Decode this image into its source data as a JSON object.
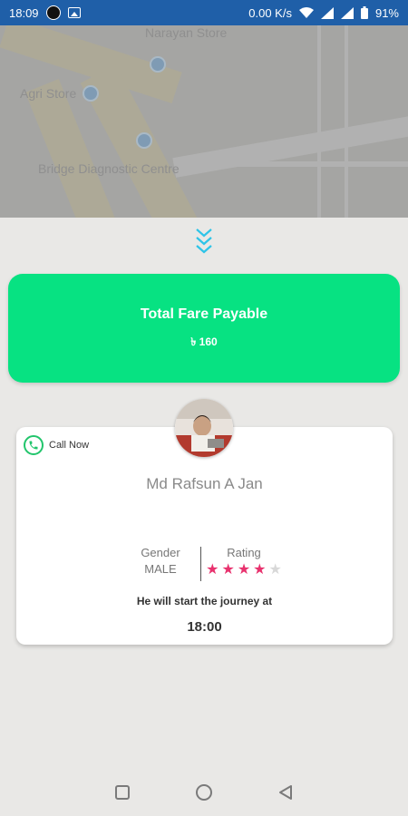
{
  "status_bar": {
    "time": "18:09",
    "network_speed": "0.00 K/s",
    "battery": "91%",
    "icons": [
      "app-icon",
      "image-icon",
      "wifi-icon",
      "signal-icon",
      "signal-icon",
      "battery-icon"
    ]
  },
  "map": {
    "labels": [
      "Narayan Store",
      "Agri Store",
      "Bridge Diagnostic Centre"
    ]
  },
  "fare": {
    "title": "Total Fare Payable",
    "amount": "৳ 160"
  },
  "driver": {
    "call_label": "Call Now",
    "name": "Md Rafsun A Jan",
    "gender_label": "Gender",
    "gender_value": "MALE",
    "rating_label": "Rating",
    "rating": 4,
    "rating_max": 5,
    "journey_text": "He will start the journey at",
    "start_time": "18:00"
  },
  "colors": {
    "fare_card": "#07e282",
    "star_on": "#e8326e",
    "star_off": "#d8d8d8",
    "chevron": "#2ec4e8",
    "status_bar": "#1f5fa8"
  },
  "nav": {
    "icons": [
      "recents-square-icon",
      "home-circle-icon",
      "back-triangle-icon"
    ]
  }
}
